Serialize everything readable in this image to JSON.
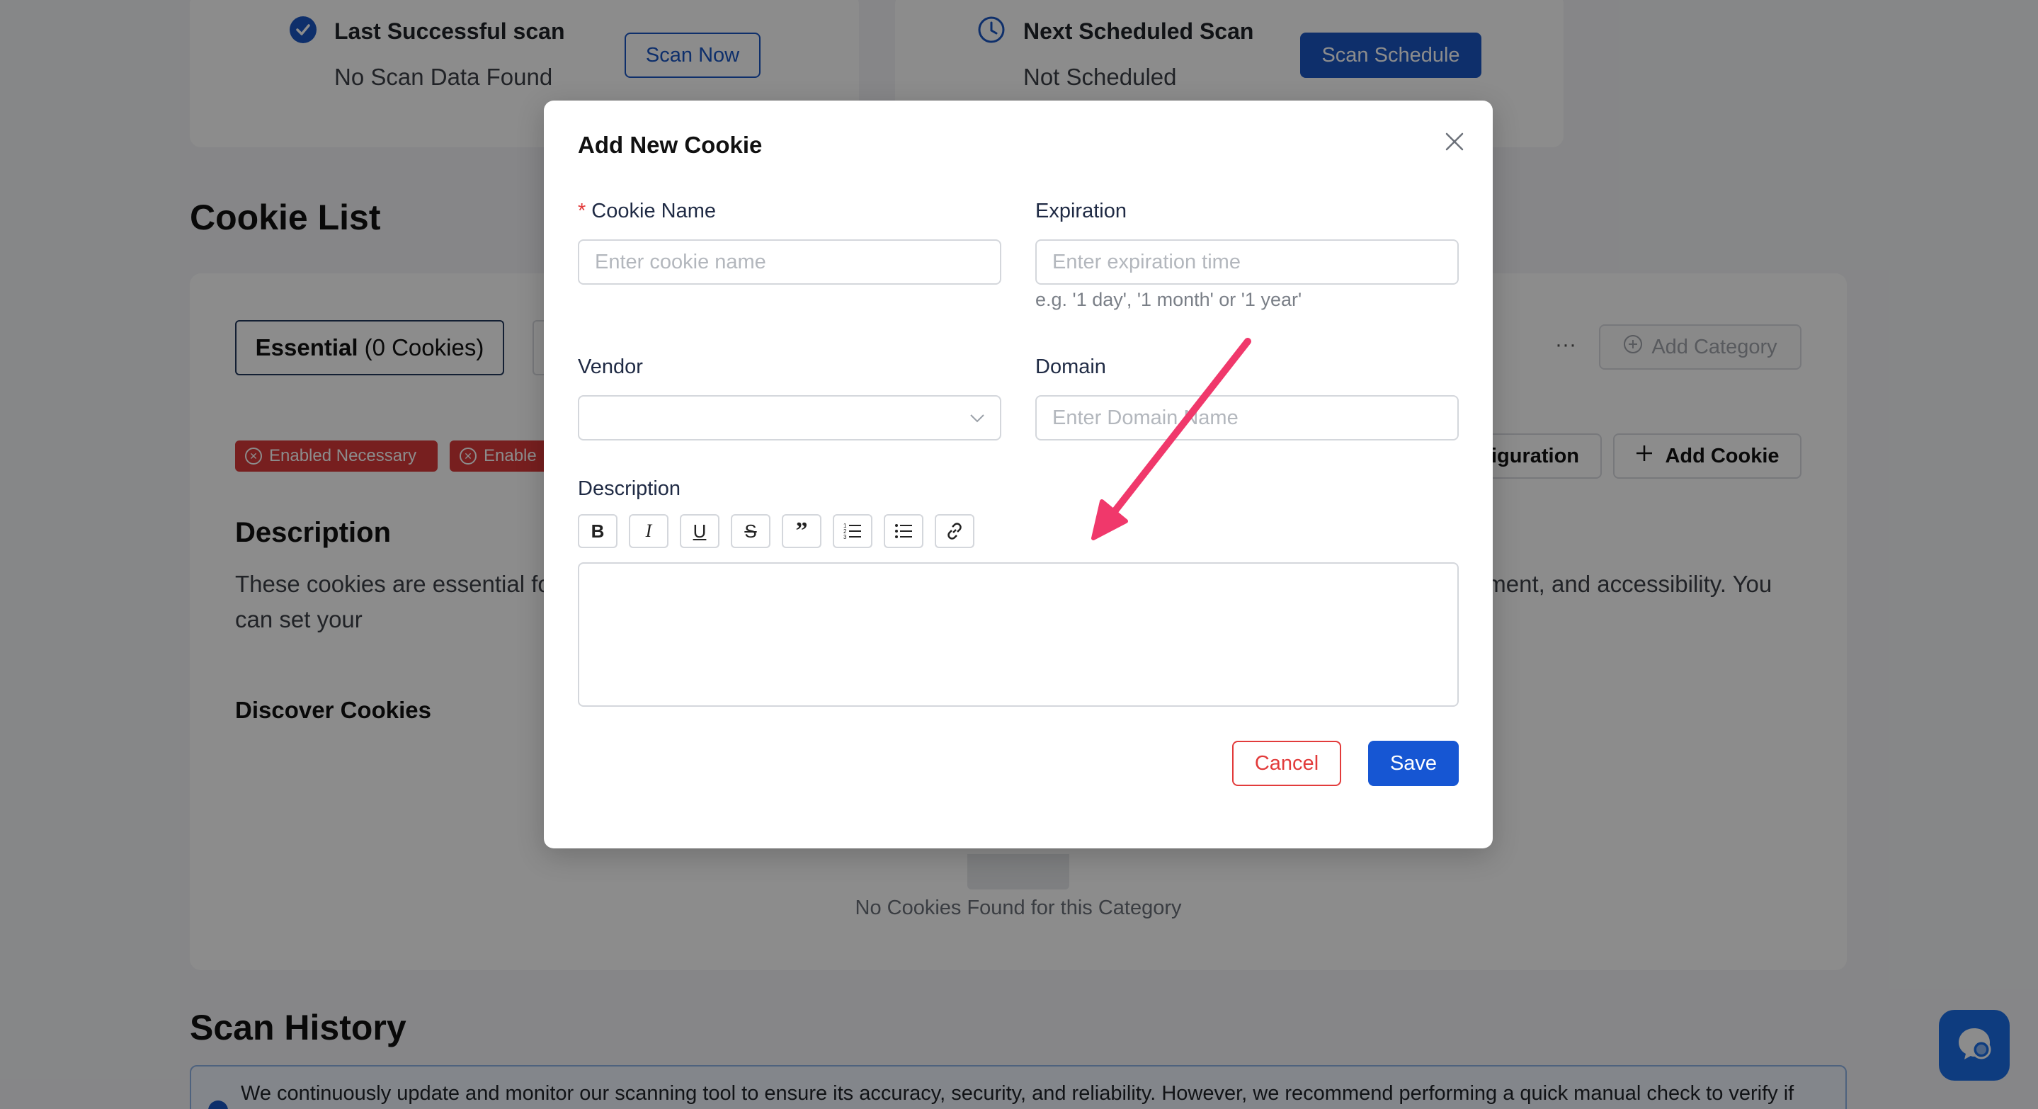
{
  "scan_cards": {
    "last": {
      "title": "Last Successful scan",
      "subtitle": "No Scan Data Found",
      "button": "Scan Now",
      "icon": "check-circle-icon"
    },
    "next": {
      "title": "Next Scheduled Scan",
      "subtitle": "Not Scheduled",
      "button": "Scan Schedule",
      "icon": "clock-icon"
    }
  },
  "cookie_list": {
    "title": "Cookie List",
    "tabs": {
      "active_name": "Essential",
      "active_count": "(0 Cookies)"
    },
    "more_label": "···",
    "add_category": "Add Category",
    "badges": [
      "Enabled Necessary",
      "Enable"
    ],
    "config_button": "iguration",
    "add_cookie": "Add Cookie",
    "description_heading": "Description",
    "description_text": "These cookies are essential fo                                                                                                                  y, network management, and accessibility. You can set your                                                                                                              thout them.",
    "discover_heading": "Discover Cookies",
    "empty_text": "No Cookies Found for this Category"
  },
  "scan_history": {
    "title": "Scan History",
    "info_text": "We continuously update and monitor our scanning tool to ensure its accuracy, security, and reliability. However, we recommend performing a quick manual check to verify if"
  },
  "modal": {
    "title": "Add New Cookie",
    "cookie_name_label": "Cookie Name",
    "cookie_name_placeholder": "Enter cookie name",
    "expiration_label": "Expiration",
    "expiration_placeholder": "Enter expiration time",
    "expiration_hint": "e.g. '1 day', '1 month' or '1 year'",
    "vendor_label": "Vendor",
    "domain_label": "Domain",
    "domain_placeholder": "Enter Domain Name",
    "description_label": "Description",
    "toolbar": [
      "bold-icon",
      "italic-icon",
      "underline-icon",
      "strikethrough-icon",
      "quote-icon",
      "ordered-list-icon",
      "bullet-list-icon",
      "link-icon"
    ],
    "cancel": "Cancel",
    "save": "Save"
  },
  "colors": {
    "primary": "#1a56c4",
    "danger": "#e23b3b",
    "arrow": "#f0386b"
  }
}
